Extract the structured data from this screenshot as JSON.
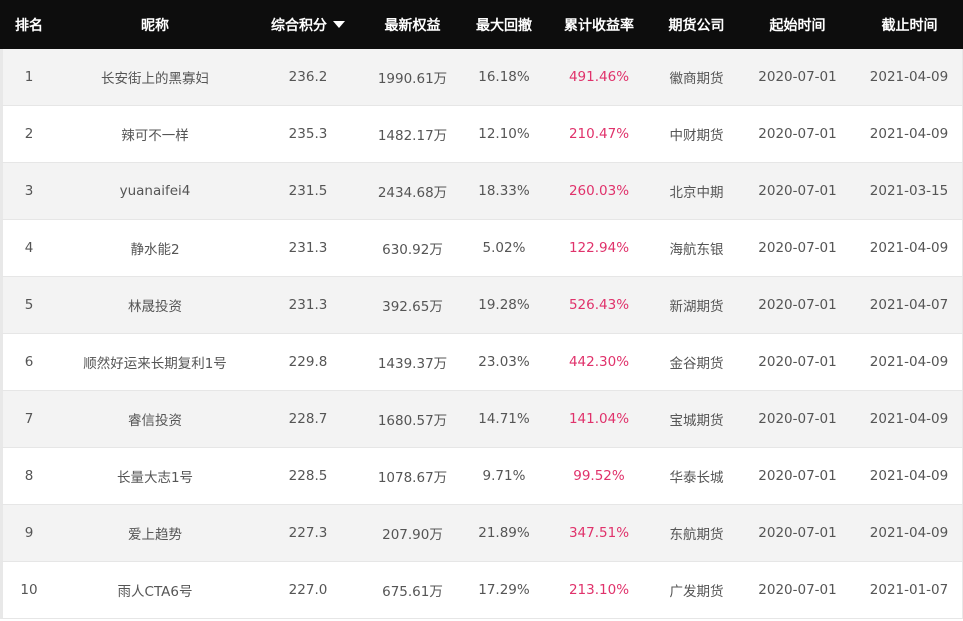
{
  "colors": {
    "header_bg": "#0d0d0d",
    "header_text": "#ffffff",
    "yield_text": "#e0326b",
    "row_alt_bg": "#f3f3f3"
  },
  "header": {
    "rank": "排名",
    "nickname": "昵称",
    "score": "综合积分",
    "score_sort_icon": "sort-desc-triangle",
    "equity": "最新权益",
    "drawdown": "最大回撤",
    "yield": "累计收益率",
    "broker": "期货公司",
    "start": "起始时间",
    "end": "截止时间"
  },
  "rows": [
    {
      "rank": "1",
      "nickname": "长安街上的黑寡妇",
      "score": "236.2",
      "equity": "1990.61万",
      "drawdown": "16.18%",
      "yield": "491.46%",
      "broker": "徽商期货",
      "start": "2020-07-01",
      "end": "2021-04-09"
    },
    {
      "rank": "2",
      "nickname": "辣可不一样",
      "score": "235.3",
      "equity": "1482.17万",
      "drawdown": "12.10%",
      "yield": "210.47%",
      "broker": "中财期货",
      "start": "2020-07-01",
      "end": "2021-04-09"
    },
    {
      "rank": "3",
      "nickname": "yuanaifei4",
      "score": "231.5",
      "equity": "2434.68万",
      "drawdown": "18.33%",
      "yield": "260.03%",
      "broker": "北京中期",
      "start": "2020-07-01",
      "end": "2021-03-15"
    },
    {
      "rank": "4",
      "nickname": "静水能2",
      "score": "231.3",
      "equity": "630.92万",
      "drawdown": "5.02%",
      "yield": "122.94%",
      "broker": "海航东银",
      "start": "2020-07-01",
      "end": "2021-04-09"
    },
    {
      "rank": "5",
      "nickname": "林晟投资",
      "score": "231.3",
      "equity": "392.65万",
      "drawdown": "19.28%",
      "yield": "526.43%",
      "broker": "新湖期货",
      "start": "2020-07-01",
      "end": "2021-04-07"
    },
    {
      "rank": "6",
      "nickname": "顺然好运来长期复利1号",
      "score": "229.8",
      "equity": "1439.37万",
      "drawdown": "23.03%",
      "yield": "442.30%",
      "broker": "金谷期货",
      "start": "2020-07-01",
      "end": "2021-04-09"
    },
    {
      "rank": "7",
      "nickname": "睿信投资",
      "score": "228.7",
      "equity": "1680.57万",
      "drawdown": "14.71%",
      "yield": "141.04%",
      "broker": "宝城期货",
      "start": "2020-07-01",
      "end": "2021-04-09"
    },
    {
      "rank": "8",
      "nickname": "长量大志1号",
      "score": "228.5",
      "equity": "1078.67万",
      "drawdown": "9.71%",
      "yield": "99.52%",
      "broker": "华泰长城",
      "start": "2020-07-01",
      "end": "2021-04-09"
    },
    {
      "rank": "9",
      "nickname": "爱上趋势",
      "score": "227.3",
      "equity": "207.90万",
      "drawdown": "21.89%",
      "yield": "347.51%",
      "broker": "东航期货",
      "start": "2020-07-01",
      "end": "2021-04-09"
    },
    {
      "rank": "10",
      "nickname": "雨人CTA6号",
      "score": "227.0",
      "equity": "675.61万",
      "drawdown": "17.29%",
      "yield": "213.10%",
      "broker": "广发期货",
      "start": "2020-07-01",
      "end": "2021-01-07"
    }
  ]
}
